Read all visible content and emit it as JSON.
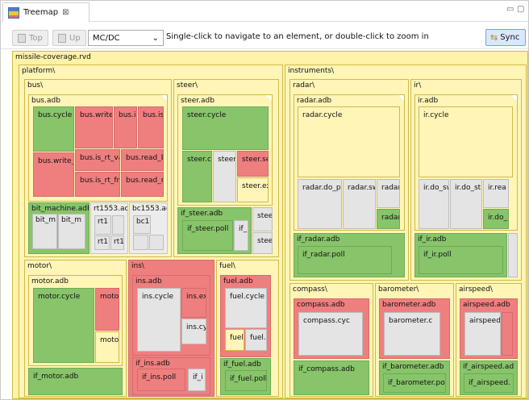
{
  "tab": {
    "title": "Treemap",
    "close": "⊠"
  },
  "window_controls": {
    "minimize": "▭",
    "maximize": "▢"
  },
  "toolbar": {
    "top_label": "Top",
    "up_label": "Up",
    "metric_selected": "MC/DC",
    "metric_arrow": "⌄",
    "hint": "Single-click to navigate to an element, or double-click to zoom in",
    "sync_label": "Sync"
  },
  "tree": {
    "root": "missile-coverage.rvd",
    "platform": "platform\\",
    "bus": "bus\\",
    "bus_adb": "bus.adb",
    "bus_cycle": "bus.cycle",
    "bus_write_": "bus.write_",
    "bus_is": "bus.is",
    "bus_is2": "bus.is",
    "bus_write_r": "bus.write_r",
    "bus_is_rt_vali": "bus.is_rt_vali",
    "bus_read_b": "bus.read_b",
    "bus_is_rt_fre": "bus.is_rt_fre",
    "bus_read_rt": "bus.read_rt",
    "bit_machine_adb": "bit_machine.adb",
    "bit_m1": "bit_m",
    "bit_m2": "bit_m",
    "rt1553_adb": "rt1553.ad",
    "rt1_a": "rt1",
    "rt1_b": "rt1",
    "rt1_c": "rt1",
    "bc1553_adb": "bc1553.ad",
    "bc1": "bc1",
    "steer": "steer\\",
    "steer_adb": "steer.adb",
    "steer_cycle": "steer.cycle",
    "steer_c": "steer.c",
    "steer_dot": "steer.",
    "steer_se": "steer.se",
    "steer_ex": "steer.ex",
    "if_steer_adb": "if_steer.adb",
    "if_steer_poll": "if_steer.poll",
    "if_": "if_",
    "stee1": "stee",
    "stee2": "stee",
    "motor": "motor\\",
    "motor_adb": "motor.adb",
    "motor_cycle": "motor.cycle",
    "moto1": "moto",
    "moto2": "moto",
    "if_motor_adb": "if_motor.adb",
    "ins": "ins\\",
    "ins_adb": "ins.adb",
    "ins_cycle": "ins.cycle",
    "ins_ex": "ins.ex",
    "ins_cy": "ins.cy",
    "if_ins_adb": "if_ins.adb",
    "if_ins_poll": "if_ins.poll",
    "if_i": "if_i",
    "fuel": "fuel\\",
    "fuel_adb": "fuel.adb",
    "fuel_cycle": "fuel.cycle",
    "fuel1": "fuel.",
    "fuel2": "fuel.",
    "if_fuel_adb": "if_fuel.adb",
    "if_fuel_poll": "if_fuel.poll",
    "instruments": "instruments\\",
    "radar": "radar\\",
    "radar_adb": "radar.adb",
    "radar_cycle": "radar.cycle",
    "radar_do_pi": "radar.do_pi",
    "radar_sw": "radar.sw",
    "radar1": "radar",
    "radar2": "radar",
    "if_radar_adb": "if_radar.adb",
    "if_radar_poll": "if_radar.poll",
    "ir": "ir\\",
    "ir_adb": "ir.adb",
    "ir_cycle": "ir.cycle",
    "ir_do_sw": "ir.do_sw",
    "ir_do_st": "ir.do_st",
    "ir_rea": "ir.rea",
    "ir_do_": "ir.do_",
    "if_ir_adb": "if_ir.adb",
    "if_ir_poll": "if_ir.poll",
    "compass": "compass\\",
    "compass_adb": "compass.adb",
    "compass_cyc": "compass.cyc",
    "if_compass_adb": "if_compass.adb",
    "barometer": "barometer\\",
    "barometer_adb": "barometer.adb",
    "barometer_c": "barometer.c",
    "if_barometer_adb": "if_barometer.adb",
    "if_barometer_po": "if_barometer.po",
    "airspeed": "airspeed\\",
    "airspeed_adb": "airspeed.adb",
    "airspeed_dot": "airspeed.",
    "if_airspeed_ad": "if_airspeed.ad",
    "if_airspeed_dot": "if_airspeed."
  },
  "colors": {
    "covered": "#88c46a",
    "uncovered": "#ef7f7f",
    "partial": "#fff5b7",
    "unknown": "#e4e4e4"
  }
}
